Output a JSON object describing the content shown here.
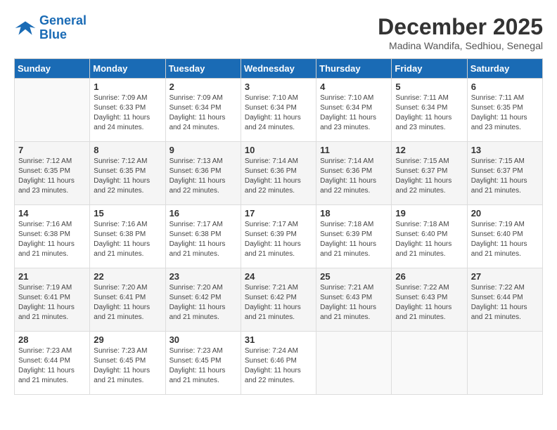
{
  "header": {
    "logo_line1": "General",
    "logo_line2": "Blue",
    "month_title": "December 2025",
    "location": "Madina Wandifa, Sedhiou, Senegal"
  },
  "weekdays": [
    "Sunday",
    "Monday",
    "Tuesday",
    "Wednesday",
    "Thursday",
    "Friday",
    "Saturday"
  ],
  "weeks": [
    [
      {
        "num": "",
        "rise": "",
        "set": "",
        "daylight": ""
      },
      {
        "num": "1",
        "rise": "Sunrise: 7:09 AM",
        "set": "Sunset: 6:33 PM",
        "daylight": "Daylight: 11 hours and 24 minutes."
      },
      {
        "num": "2",
        "rise": "Sunrise: 7:09 AM",
        "set": "Sunset: 6:34 PM",
        "daylight": "Daylight: 11 hours and 24 minutes."
      },
      {
        "num": "3",
        "rise": "Sunrise: 7:10 AM",
        "set": "Sunset: 6:34 PM",
        "daylight": "Daylight: 11 hours and 24 minutes."
      },
      {
        "num": "4",
        "rise": "Sunrise: 7:10 AM",
        "set": "Sunset: 6:34 PM",
        "daylight": "Daylight: 11 hours and 23 minutes."
      },
      {
        "num": "5",
        "rise": "Sunrise: 7:11 AM",
        "set": "Sunset: 6:34 PM",
        "daylight": "Daylight: 11 hours and 23 minutes."
      },
      {
        "num": "6",
        "rise": "Sunrise: 7:11 AM",
        "set": "Sunset: 6:35 PM",
        "daylight": "Daylight: 11 hours and 23 minutes."
      }
    ],
    [
      {
        "num": "7",
        "rise": "Sunrise: 7:12 AM",
        "set": "Sunset: 6:35 PM",
        "daylight": "Daylight: 11 hours and 23 minutes."
      },
      {
        "num": "8",
        "rise": "Sunrise: 7:12 AM",
        "set": "Sunset: 6:35 PM",
        "daylight": "Daylight: 11 hours and 22 minutes."
      },
      {
        "num": "9",
        "rise": "Sunrise: 7:13 AM",
        "set": "Sunset: 6:36 PM",
        "daylight": "Daylight: 11 hours and 22 minutes."
      },
      {
        "num": "10",
        "rise": "Sunrise: 7:14 AM",
        "set": "Sunset: 6:36 PM",
        "daylight": "Daylight: 11 hours and 22 minutes."
      },
      {
        "num": "11",
        "rise": "Sunrise: 7:14 AM",
        "set": "Sunset: 6:36 PM",
        "daylight": "Daylight: 11 hours and 22 minutes."
      },
      {
        "num": "12",
        "rise": "Sunrise: 7:15 AM",
        "set": "Sunset: 6:37 PM",
        "daylight": "Daylight: 11 hours and 22 minutes."
      },
      {
        "num": "13",
        "rise": "Sunrise: 7:15 AM",
        "set": "Sunset: 6:37 PM",
        "daylight": "Daylight: 11 hours and 21 minutes."
      }
    ],
    [
      {
        "num": "14",
        "rise": "Sunrise: 7:16 AM",
        "set": "Sunset: 6:38 PM",
        "daylight": "Daylight: 11 hours and 21 minutes."
      },
      {
        "num": "15",
        "rise": "Sunrise: 7:16 AM",
        "set": "Sunset: 6:38 PM",
        "daylight": "Daylight: 11 hours and 21 minutes."
      },
      {
        "num": "16",
        "rise": "Sunrise: 7:17 AM",
        "set": "Sunset: 6:38 PM",
        "daylight": "Daylight: 11 hours and 21 minutes."
      },
      {
        "num": "17",
        "rise": "Sunrise: 7:17 AM",
        "set": "Sunset: 6:39 PM",
        "daylight": "Daylight: 11 hours and 21 minutes."
      },
      {
        "num": "18",
        "rise": "Sunrise: 7:18 AM",
        "set": "Sunset: 6:39 PM",
        "daylight": "Daylight: 11 hours and 21 minutes."
      },
      {
        "num": "19",
        "rise": "Sunrise: 7:18 AM",
        "set": "Sunset: 6:40 PM",
        "daylight": "Daylight: 11 hours and 21 minutes."
      },
      {
        "num": "20",
        "rise": "Sunrise: 7:19 AM",
        "set": "Sunset: 6:40 PM",
        "daylight": "Daylight: 11 hours and 21 minutes."
      }
    ],
    [
      {
        "num": "21",
        "rise": "Sunrise: 7:19 AM",
        "set": "Sunset: 6:41 PM",
        "daylight": "Daylight: 11 hours and 21 minutes."
      },
      {
        "num": "22",
        "rise": "Sunrise: 7:20 AM",
        "set": "Sunset: 6:41 PM",
        "daylight": "Daylight: 11 hours and 21 minutes."
      },
      {
        "num": "23",
        "rise": "Sunrise: 7:20 AM",
        "set": "Sunset: 6:42 PM",
        "daylight": "Daylight: 11 hours and 21 minutes."
      },
      {
        "num": "24",
        "rise": "Sunrise: 7:21 AM",
        "set": "Sunset: 6:42 PM",
        "daylight": "Daylight: 11 hours and 21 minutes."
      },
      {
        "num": "25",
        "rise": "Sunrise: 7:21 AM",
        "set": "Sunset: 6:43 PM",
        "daylight": "Daylight: 11 hours and 21 minutes."
      },
      {
        "num": "26",
        "rise": "Sunrise: 7:22 AM",
        "set": "Sunset: 6:43 PM",
        "daylight": "Daylight: 11 hours and 21 minutes."
      },
      {
        "num": "27",
        "rise": "Sunrise: 7:22 AM",
        "set": "Sunset: 6:44 PM",
        "daylight": "Daylight: 11 hours and 21 minutes."
      }
    ],
    [
      {
        "num": "28",
        "rise": "Sunrise: 7:23 AM",
        "set": "Sunset: 6:44 PM",
        "daylight": "Daylight: 11 hours and 21 minutes."
      },
      {
        "num": "29",
        "rise": "Sunrise: 7:23 AM",
        "set": "Sunset: 6:45 PM",
        "daylight": "Daylight: 11 hours and 21 minutes."
      },
      {
        "num": "30",
        "rise": "Sunrise: 7:23 AM",
        "set": "Sunset: 6:45 PM",
        "daylight": "Daylight: 11 hours and 21 minutes."
      },
      {
        "num": "31",
        "rise": "Sunrise: 7:24 AM",
        "set": "Sunset: 6:46 PM",
        "daylight": "Daylight: 11 hours and 22 minutes."
      },
      {
        "num": "",
        "rise": "",
        "set": "",
        "daylight": ""
      },
      {
        "num": "",
        "rise": "",
        "set": "",
        "daylight": ""
      },
      {
        "num": "",
        "rise": "",
        "set": "",
        "daylight": ""
      }
    ]
  ]
}
